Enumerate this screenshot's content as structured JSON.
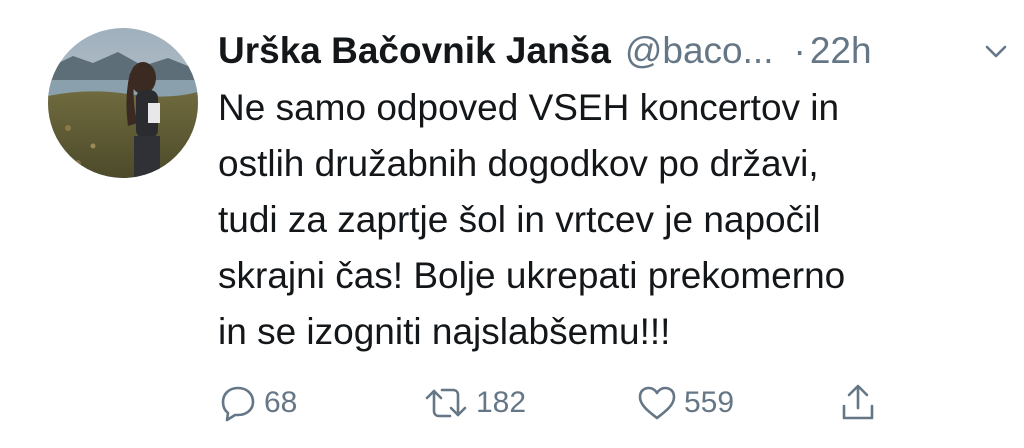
{
  "tweet": {
    "author_name": "Urška Bačovnik Janša",
    "handle": "@baco...",
    "separator": "·",
    "time": "22h",
    "text_lines": [
      "Ne samo odpoved VSEH koncertov in",
      "ostlih družabnih dogodkov po državi,",
      "tudi za zaprtje šol in vrtcev je napočil",
      "skrajni čas! Bolje ukrepati prekomerno",
      "in se izogniti najslabšemu!!!"
    ]
  },
  "actions": {
    "replies": "68",
    "retweets": "182",
    "likes": "559"
  },
  "icons": {
    "avatar": "profile-photo",
    "menu": "chevron-down-icon",
    "reply": "reply-icon",
    "retweet": "retweet-icon",
    "like": "heart-icon",
    "share": "share-icon"
  },
  "colors": {
    "text": "#14171a",
    "muted": "#657786",
    "background": "#ffffff"
  }
}
